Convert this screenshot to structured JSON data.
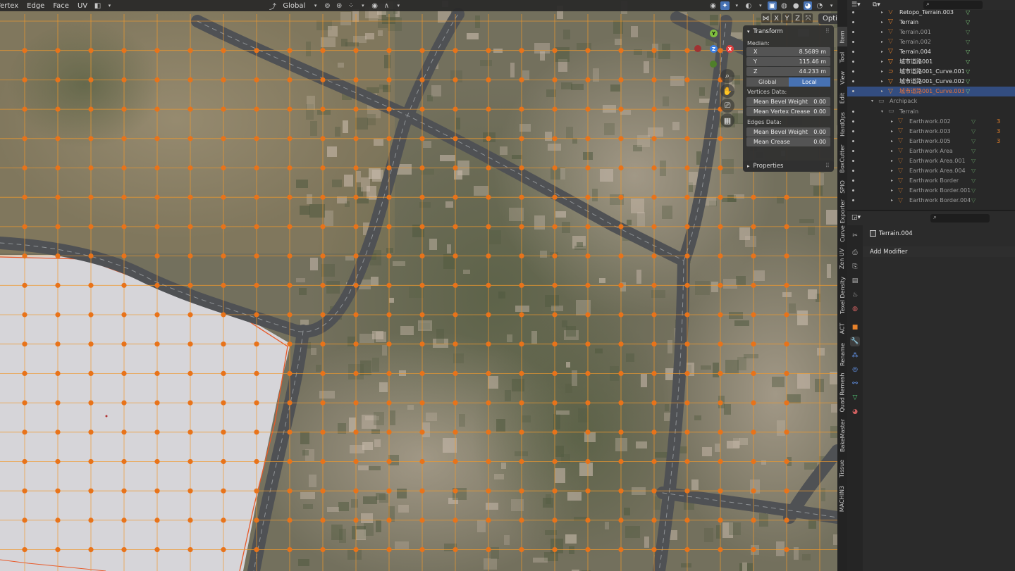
{
  "header": {
    "menus": [
      "Vertex",
      "Edge",
      "Face",
      "UV"
    ],
    "orientation": "Global",
    "options_label": "Options",
    "axis_buttons": [
      "X",
      "Y",
      "Z"
    ]
  },
  "gizmo": {
    "y": "Y",
    "z": "Z",
    "x": "X"
  },
  "npanel": {
    "title": "Transform",
    "median_label": "Median:",
    "fields": [
      {
        "label": "X",
        "value": "8.5689 m"
      },
      {
        "label": "Y",
        "value": "115.46 m"
      },
      {
        "label": "Z",
        "value": "44.233 m"
      }
    ],
    "space_global": "Global",
    "space_local": "Local",
    "vertices_label": "Vertices Data:",
    "vertex_fields": [
      {
        "label": "Mean Bevel Weight",
        "value": "0.00"
      },
      {
        "label": "Mean Vertex Crease",
        "value": "0.00"
      }
    ],
    "edges_label": "Edges Data:",
    "edge_fields": [
      {
        "label": "Mean Bevel Weight",
        "value": "0.00"
      },
      {
        "label": "Mean Crease",
        "value": "0.00"
      }
    ],
    "properties_label": "Properties"
  },
  "tabs": [
    "Item",
    "Tool",
    "View",
    "Edit",
    "HardOps",
    "BoxCutter",
    "SPIO",
    "Curve Exporter",
    "Zen UV",
    "Texel Density",
    "ACT",
    "Rename",
    "Quad Remesh",
    "BakeMaster",
    "Tissue",
    "MACHIN3"
  ],
  "outliner": {
    "rows": [
      {
        "name": "Retopo_Terrain.003",
        "kind": "mesh",
        "indent": 1,
        "state": "normal"
      },
      {
        "name": "Terrain",
        "kind": "mesh",
        "indent": 1,
        "state": "normal"
      },
      {
        "name": "Terrain.001",
        "kind": "mesh",
        "indent": 1,
        "state": "dim"
      },
      {
        "name": "Terrain.002",
        "kind": "mesh",
        "indent": 1,
        "state": "dim"
      },
      {
        "name": "Terrain.004",
        "kind": "mesh",
        "indent": 1,
        "state": "active"
      },
      {
        "name": "城市道路001",
        "kind": "mesh",
        "indent": 1,
        "state": "normal"
      },
      {
        "name": "城市道路001_Curve.001",
        "kind": "curve",
        "indent": 1,
        "state": "normal"
      },
      {
        "name": "城市道路001_Curve.002",
        "kind": "mesh",
        "indent": 1,
        "state": "normal"
      },
      {
        "name": "城市道路001_Curve.003",
        "kind": "mesh",
        "indent": 1,
        "state": "selected"
      },
      {
        "name": "Archipack",
        "kind": "collection",
        "indent": 0,
        "state": "dim"
      },
      {
        "name": "Terrain",
        "kind": "collection",
        "indent": 1,
        "state": "dim"
      },
      {
        "name": "Earthwork.002",
        "kind": "mesh",
        "indent": 2,
        "state": "dim",
        "count": "3"
      },
      {
        "name": "Earthwork.003",
        "kind": "mesh",
        "indent": 2,
        "state": "dim",
        "count": "3"
      },
      {
        "name": "Earthwork.005",
        "kind": "mesh",
        "indent": 2,
        "state": "dim",
        "count": "3"
      },
      {
        "name": "Earthwork Area",
        "kind": "mesh",
        "indent": 2,
        "state": "dim"
      },
      {
        "name": "Earthwork Area.001",
        "kind": "mesh",
        "indent": 2,
        "state": "dim"
      },
      {
        "name": "Earthwork Area.004",
        "kind": "mesh",
        "indent": 2,
        "state": "dim"
      },
      {
        "name": "Earthwork Border",
        "kind": "mesh",
        "indent": 2,
        "state": "dim"
      },
      {
        "name": "Earthwork Border.001",
        "kind": "mesh",
        "indent": 2,
        "state": "dim"
      },
      {
        "name": "Earthwork Border.004",
        "kind": "mesh",
        "indent": 2,
        "state": "dim"
      }
    ]
  },
  "properties": {
    "object_name": "Terrain.004",
    "add_modifier": "Add Modifier"
  },
  "colors": {
    "accent": "#4772b3",
    "vertex": "#e8731a",
    "edge": "#f09a2e",
    "selected_text": "#e8743b"
  }
}
